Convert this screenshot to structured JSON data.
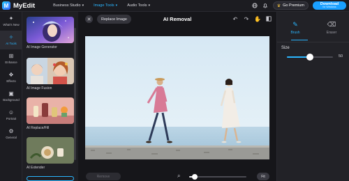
{
  "app": {
    "name": "MyEdit"
  },
  "nav": [
    {
      "label": "Business Studio",
      "active": false
    },
    {
      "label": "Image Tools",
      "active": true
    },
    {
      "label": "Audio Tools",
      "active": false
    }
  ],
  "top_right": {
    "premium_label": "Go Premium",
    "download_label": "Download",
    "download_sub": "for Windows"
  },
  "rail": [
    {
      "label": "What's New",
      "icon": "new-icon",
      "active": false
    },
    {
      "label": "AI Tools",
      "icon": "ai-tools-icon",
      "active": true
    },
    {
      "label": "Enhance",
      "icon": "enhance-icon",
      "active": false
    },
    {
      "label": "Effects",
      "icon": "effects-icon",
      "active": false
    },
    {
      "label": "Background",
      "icon": "background-icon",
      "active": false
    },
    {
      "label": "Portrait",
      "icon": "portrait-icon",
      "active": false
    },
    {
      "label": "General",
      "icon": "general-icon",
      "active": false
    }
  ],
  "tools": [
    {
      "label": "AI Image Generator"
    },
    {
      "label": "AI Image Fusion"
    },
    {
      "label": "AI Replace/Fill"
    },
    {
      "label": "AI Extender"
    }
  ],
  "workspace": {
    "replace_label": "Replace Image",
    "title": "AI Removal",
    "remove_label": "Remove",
    "fit_label": "Fit",
    "zoom_level": 0.1
  },
  "right_panel": {
    "modes": [
      {
        "label": "Brush",
        "icon": "brush-icon",
        "active": true
      },
      {
        "label": "Eraser",
        "icon": "eraser-icon",
        "active": false
      }
    ],
    "size_label": "Size",
    "size_value": "50",
    "size_fraction": 0.5
  },
  "colors": {
    "accent": "#2bb6ff",
    "background": "#16161a",
    "panel": "#1f1f24"
  }
}
